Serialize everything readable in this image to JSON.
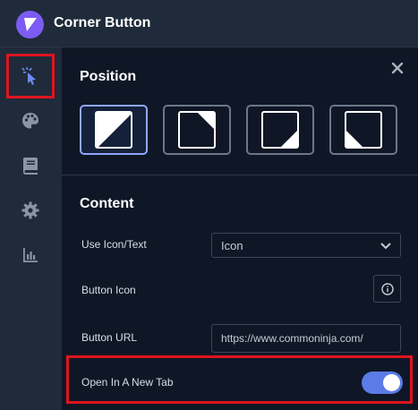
{
  "app": {
    "title": "Corner Button"
  },
  "sidebar": {
    "items": [
      {
        "name": "cursor",
        "icon": "cursor-click-icon",
        "active": true
      },
      {
        "name": "palette",
        "icon": "palette-icon",
        "active": false
      },
      {
        "name": "book",
        "icon": "book-icon",
        "active": false
      },
      {
        "name": "settings",
        "icon": "gear-icon",
        "active": false
      },
      {
        "name": "analytics",
        "icon": "bar-chart-icon",
        "active": false
      }
    ]
  },
  "panel": {
    "position_title": "Position",
    "position_options": [
      "top-left",
      "top-right",
      "bottom-right",
      "bottom-left"
    ],
    "selected_position": "top-left",
    "content_title": "Content",
    "use_icon_text_label": "Use Icon/Text",
    "use_icon_text_value": "Icon",
    "button_icon_label": "Button Icon",
    "button_url_label": "Button URL",
    "button_url_value": "https://www.commoninja.com/",
    "open_new_tab_label": "Open In A New Tab",
    "open_new_tab_enabled": true
  },
  "colors": {
    "accent": "#5b7be6",
    "logo": "#7c5cf2",
    "highlight": "#e0141e"
  }
}
